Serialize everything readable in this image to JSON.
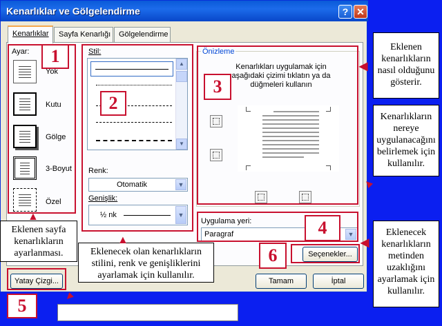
{
  "window": {
    "title": "Kenarlıklar ve Gölgelendirme",
    "help_label": "?",
    "close_label": "✕"
  },
  "tabs": [
    {
      "label": "Kenarlıklar"
    },
    {
      "label": "Sayfa Kenarlığı"
    },
    {
      "label": "Gölgelendirme"
    }
  ],
  "setting": {
    "label": "Ayar:",
    "items": [
      {
        "label": "Yok"
      },
      {
        "label": "Kutu"
      },
      {
        "label": "Gölge"
      },
      {
        "label": "3-Boyut"
      },
      {
        "label": "Özel"
      }
    ]
  },
  "style": {
    "label": "Stil:"
  },
  "color": {
    "label": "Renk:",
    "value": "Otomatik"
  },
  "width": {
    "label": "Genişlik:",
    "value": "½ nk"
  },
  "preview": {
    "label": "Önizleme",
    "instruction": "Kenarlıkları uygulamak için aşağıdaki çizimi tıklatın ya da düğmeleri kullanın"
  },
  "apply_to": {
    "label": "Uygulama yeri:",
    "value": "Paragraf"
  },
  "buttons": {
    "options": "Seçenekler...",
    "horizontal_line": "Yatay Çizgi...",
    "ok": "Tamam",
    "cancel": "İptal"
  },
  "numbers": {
    "n1": "1",
    "n2": "2",
    "n3": "3",
    "n4": "4",
    "n5": "5",
    "n6": "6"
  },
  "notes": {
    "preview": "Eklenen kenarlıkların nasıl olduğunu gösterir.",
    "apply": "Kenarlıkların nereye uygulanacağını belirlemek için kullanılır.",
    "options": "Eklenecek kenarlıkların metinden uzaklığını ayarlamak için kullanılır.",
    "setting": "Eklenen sayfa kenarlıkların ayarlanması.",
    "style": "Eklenecek olan kenarlıkların stilini, renk ve genişliklerini ayarlamak için kullanılır."
  },
  "colors": {
    "background": "#0b1ff0",
    "annotation": "#c8102e",
    "titlebar": "#0a5ad8"
  }
}
